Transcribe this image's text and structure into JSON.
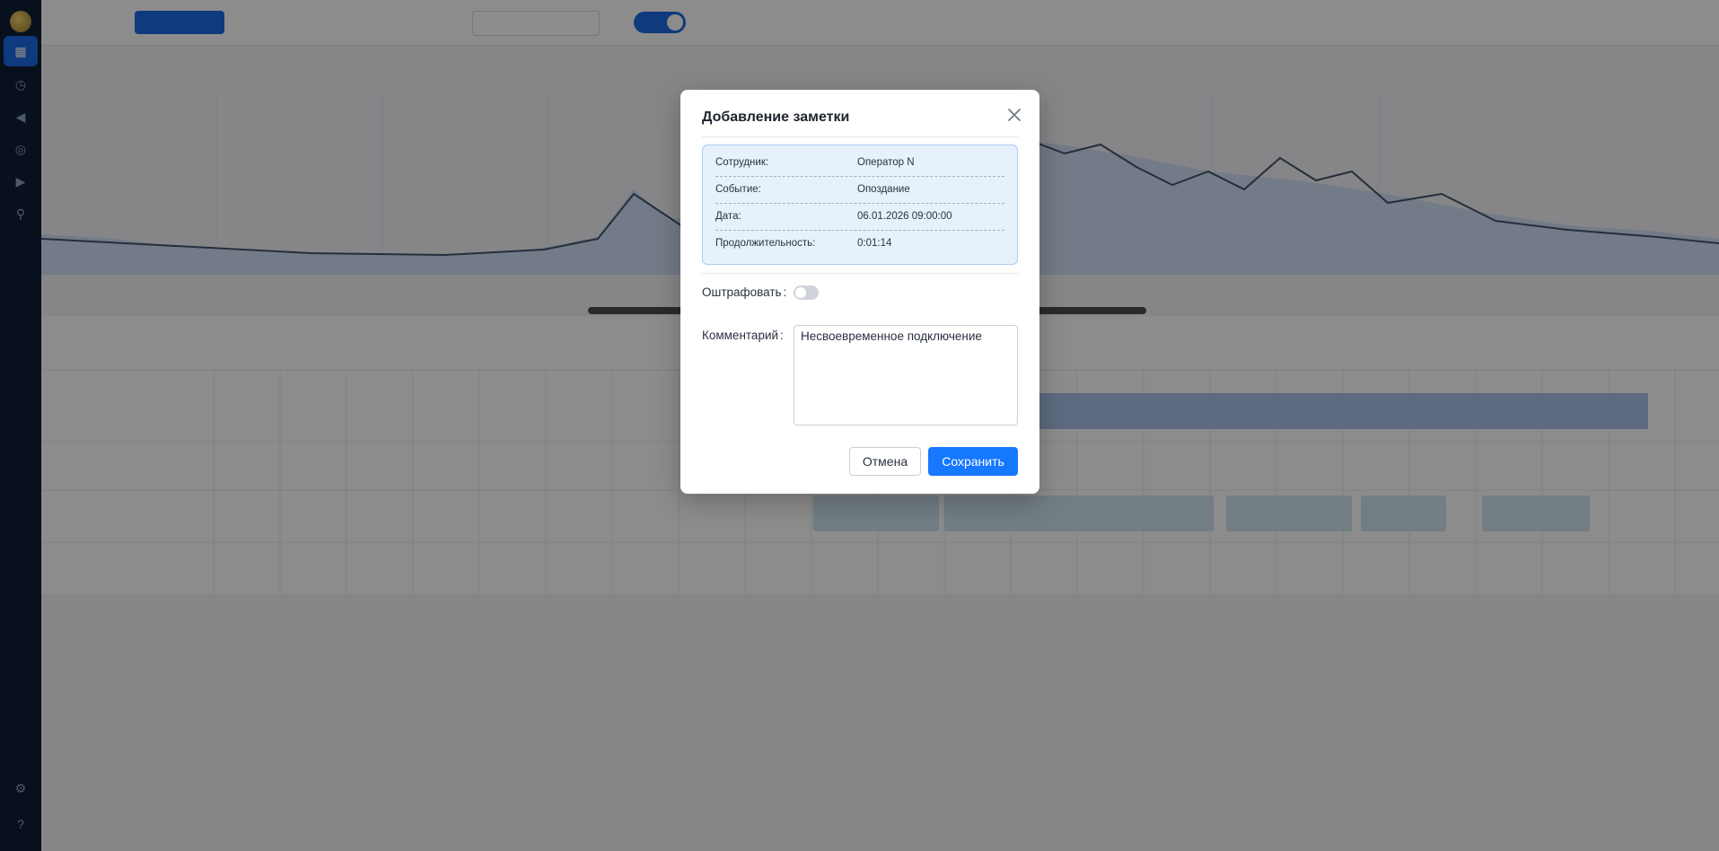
{
  "modal": {
    "title": "Добавление заметки",
    "info": [
      {
        "key": "Сотрудник:",
        "value": "Оператор N"
      },
      {
        "key": "Событие:",
        "value": "Опоздание"
      },
      {
        "key": "Дата:",
        "value": "06.01.2026 09:00:00"
      },
      {
        "key": "Продолжительность:",
        "value": "0:01:14"
      }
    ],
    "fine_label": "Оштрафовать",
    "fine_enabled": false,
    "comment_label": "Комментарий",
    "comment_value": "Несвоевременное подключение",
    "cancel_label": "Отмена",
    "save_label": "Сохранить"
  },
  "colors": {
    "overlay": "#00000073",
    "primary": "#1677ff",
    "info_bg": "#e6f1fc",
    "info_border": "#a9cdf1",
    "sidebar": "#0f1e36"
  },
  "icons": {
    "close": "close-icon"
  }
}
